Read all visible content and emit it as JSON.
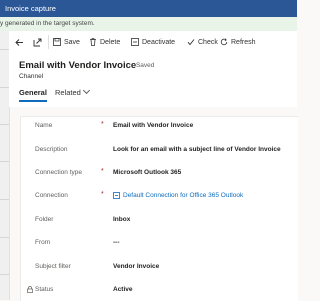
{
  "app": {
    "title": "Invoice capture"
  },
  "notice": {
    "text": "y generated in the target system."
  },
  "toolbar": {
    "save": "Save",
    "delete": "Delete",
    "deactivate": "Deactivate",
    "check": "Check",
    "refresh": "Refresh"
  },
  "record": {
    "title": "Email with Vendor Invoice",
    "saved_status": "- Saved",
    "entity": "Channel"
  },
  "tabs": {
    "general": "General",
    "related": "Related"
  },
  "fields": [
    {
      "label": "Name",
      "value": "Email with Vendor Invoice",
      "required": "*"
    },
    {
      "label": "Description",
      "value": "Look for an email with a subject line of Vendor Invoice"
    },
    {
      "label": "Connection type",
      "value": "Microsoft Outlook 365",
      "required": "*"
    },
    {
      "label": "Connection",
      "value": "Default Connection for Office 365 Outlook",
      "required": "*"
    },
    {
      "label": "Folder",
      "value": "Inbox"
    },
    {
      "label": "From",
      "value": "---"
    },
    {
      "label": "Subject filter",
      "value": "Vendor Invoice"
    },
    {
      "label": "Status",
      "value": "Active"
    }
  ],
  "colors": {
    "topbar": "#2b5797",
    "notice_bg": "#e9f4e8",
    "accent": "#0f6cbd",
    "required": "#a4262c"
  },
  "icons": [
    "back-arrow-icon",
    "open-in-new-icon",
    "save-icon",
    "delete-icon",
    "deactivate-icon",
    "check-icon",
    "refresh-icon",
    "link-icon",
    "lock-icon",
    "chevron-down-icon"
  ]
}
